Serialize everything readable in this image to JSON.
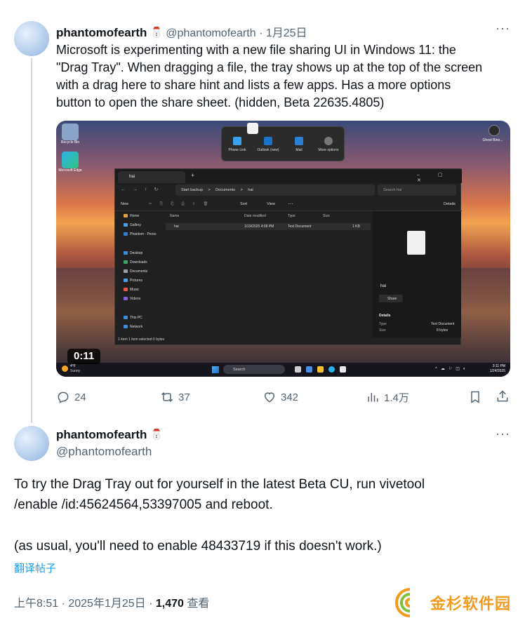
{
  "tweet1": {
    "display_name": "phantomofearth",
    "handle": "@phantomofearth",
    "date": "· 1月25日",
    "text_lines": [
      "Microsoft is experimenting with a new file sharing UI in Windows 11: the",
      "\"Drag Tray\". When dragging a file, the tray shows up at the top of the screen",
      "with a drag here to share hint and lists a few apps. Has a more options",
      "button to open the share sheet. (hidden, Beta 22635.4805)"
    ],
    "more_label": "···"
  },
  "media": {
    "duration": "0:11",
    "desktop_icons": [
      "Recycle Bin",
      "Microsoft Edge"
    ],
    "drag_tray": {
      "items": [
        "Phone Link",
        "Outlook (new)",
        "Mail",
        "More options"
      ]
    },
    "explorer": {
      "tab_title": "hai",
      "address": [
        "Start backup",
        ">",
        "Documents",
        ">",
        "hai"
      ],
      "search_placeholder": "Search hai",
      "toolbar": {
        "new": "New",
        "sort": "Sort",
        "view": "View",
        "details": "Details"
      },
      "sidebar": [
        "Home",
        "Gallery",
        "Phantom - Perso",
        "Desktop",
        "Downloads",
        "Documents",
        "Pictures",
        "Music",
        "Videos",
        "This PC",
        "Network"
      ],
      "columns": [
        "Name",
        "Date modified",
        "Type",
        "Size"
      ],
      "row": {
        "name": "hai",
        "date": "1/19/2025 4:08 PM",
        "type": "Text Document",
        "size": "1 KB"
      },
      "details": {
        "file": "hai",
        "share": "Share",
        "heading": "Details",
        "type_label": "Type",
        "type_value": "Text Document",
        "size_label": "Size",
        "size_value": "8 bytes"
      },
      "status": "1 item   1 item selected  0 bytes"
    },
    "taskbar": {
      "weather_temp": "4°F",
      "weather_cond": "Sunny",
      "search": "Search",
      "time": "3:11 PM",
      "date": "1/24/2025"
    },
    "top_right_label": "Ghost Bino..."
  },
  "actions": {
    "replies": "24",
    "retweets": "37",
    "likes": "342",
    "views": "1.4万"
  },
  "tweet2": {
    "display_name": "phantomofearth",
    "handle": "@phantomofearth",
    "more_label": "···",
    "line1": "To try the Drag Tray out for yourself in the latest Beta CU, run vivetool",
    "line2": "/enable /id:45624564,53397005 and reboot.",
    "line3": "(as usual, you'll need to enable 48433719 if this doesn't work.)",
    "translate": "翻译帖子",
    "meta_time": "上午8:51 · 2025年1月25日 · ",
    "meta_views_count": "1,470",
    "meta_views_label": " 查看"
  },
  "watermark": {
    "text": "金杉软件园"
  },
  "colors": {
    "accent": "#1d9bf0",
    "text": "#0f1419",
    "muted": "#536471",
    "watermark": "#f39a1e"
  }
}
